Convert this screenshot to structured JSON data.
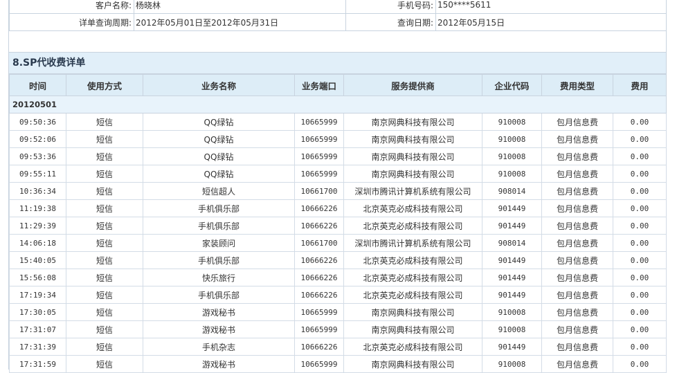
{
  "customer": {
    "name_label": "客户名称:",
    "name_value": "杨晓林",
    "phone_label": "手机号码:",
    "phone_value": "150****5611",
    "period_label": "详单查询周期:",
    "period_value": "2012年05月01日至2012年05月31日",
    "query_date_label": "查询日期:",
    "query_date_value": "2012年05月15日"
  },
  "section": {
    "title": "8.SP代收费详单"
  },
  "table": {
    "columns": [
      "时间",
      "使用方式",
      "业务名称",
      "业务端口",
      "服务提供商",
      "企业代码",
      "费用类型",
      "费用"
    ],
    "date_group": "20120501",
    "rows": [
      [
        "09:50:36",
        "短信",
        "QQ绿钻",
        "10665999",
        "南京网典科技有限公司",
        "910008",
        "包月信息费",
        "0.00"
      ],
      [
        "09:52:06",
        "短信",
        "QQ绿钻",
        "10665999",
        "南京网典科技有限公司",
        "910008",
        "包月信息费",
        "0.00"
      ],
      [
        "09:53:36",
        "短信",
        "QQ绿钻",
        "10665999",
        "南京网典科技有限公司",
        "910008",
        "包月信息费",
        "0.00"
      ],
      [
        "09:55:11",
        "短信",
        "QQ绿钻",
        "10665999",
        "南京网典科技有限公司",
        "910008",
        "包月信息费",
        "0.00"
      ],
      [
        "10:36:34",
        "短信",
        "短信超人",
        "10661700",
        "深圳市腾讯计算机系统有限公司",
        "908014",
        "包月信息费",
        "0.00"
      ],
      [
        "11:19:38",
        "短信",
        "手机俱乐部",
        "10666226",
        "北京英克必成科技有限公司",
        "901449",
        "包月信息费",
        "0.00"
      ],
      [
        "11:29:39",
        "短信",
        "手机俱乐部",
        "10666226",
        "北京英克必成科技有限公司",
        "901449",
        "包月信息费",
        "0.00"
      ],
      [
        "14:06:18",
        "短信",
        "家装顾问",
        "10661700",
        "深圳市腾讯计算机系统有限公司",
        "908014",
        "包月信息费",
        "0.00"
      ],
      [
        "15:40:05",
        "短信",
        "手机俱乐部",
        "10666226",
        "北京英克必成科技有限公司",
        "901449",
        "包月信息费",
        "0.00"
      ],
      [
        "15:56:08",
        "短信",
        "快乐旅行",
        "10666226",
        "北京英克必成科技有限公司",
        "901449",
        "包月信息费",
        "0.00"
      ],
      [
        "17:19:34",
        "短信",
        "手机俱乐部",
        "10666226",
        "北京英克必成科技有限公司",
        "901449",
        "包月信息费",
        "0.00"
      ],
      [
        "17:30:05",
        "短信",
        "游戏秘书",
        "10665999",
        "南京网典科技有限公司",
        "910008",
        "包月信息费",
        "0.00"
      ],
      [
        "17:31:07",
        "短信",
        "游戏秘书",
        "10665999",
        "南京网典科技有限公司",
        "910008",
        "包月信息费",
        "0.00"
      ],
      [
        "17:31:39",
        "短信",
        "手机杂志",
        "10666226",
        "北京英克必成科技有限公司",
        "901449",
        "包月信息费",
        "0.00"
      ],
      [
        "17:31:59",
        "短信",
        "游戏秘书",
        "10665999",
        "南京网典科技有限公司",
        "910008",
        "包月信息费",
        "0.00"
      ]
    ]
  }
}
